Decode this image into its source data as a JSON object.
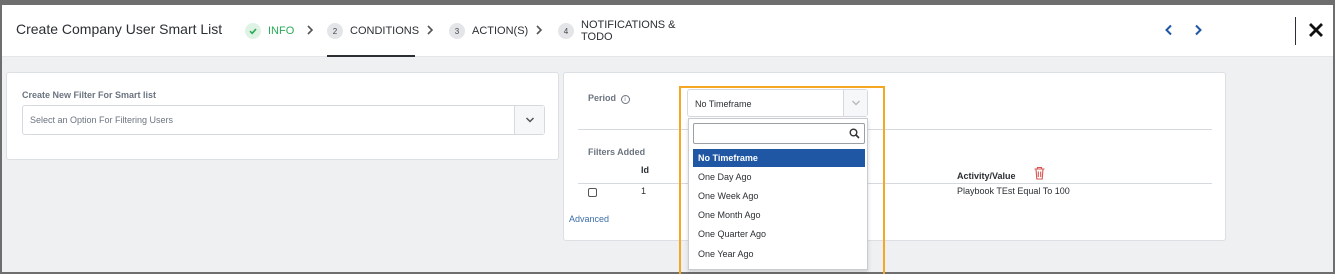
{
  "header": {
    "title": "Create Company User Smart List",
    "steps": [
      {
        "num": "",
        "label": "INFO",
        "state": "done"
      },
      {
        "num": "2",
        "label": "CONDITIONS",
        "state": "active"
      },
      {
        "num": "3",
        "label": "ACTION(S)",
        "state": "pending"
      },
      {
        "num": "4",
        "label": "NOTIFICATIONS &",
        "label2": "TODO",
        "state": "pending"
      }
    ]
  },
  "left_panel": {
    "filter_label": "Create New Filter For Smart list",
    "filter_placeholder": "Select an Option For Filtering Users"
  },
  "right_panel": {
    "period_label": "Period",
    "period_value": "No Timeframe",
    "filters_added_label": "Filters Added",
    "columns": {
      "id": "Id",
      "activity": "Activity/Value"
    },
    "rows": [
      {
        "id": "1",
        "activity": "Playbook TEst Equal To 100"
      }
    ],
    "advanced_link": "Advanced"
  },
  "dropdown": {
    "search_value": "",
    "options": [
      "No Timeframe",
      "One Day Ago",
      "One Week Ago",
      "One Month Ago",
      "One Quarter Ago",
      "One Year Ago"
    ],
    "selected_index": 0
  },
  "colors": {
    "accent_green": "#2aa956",
    "selected_blue": "#1f57a5",
    "highlight_orange": "#f5a623",
    "delete_red": "#d9534f",
    "nav_blue": "#1f57a5"
  }
}
